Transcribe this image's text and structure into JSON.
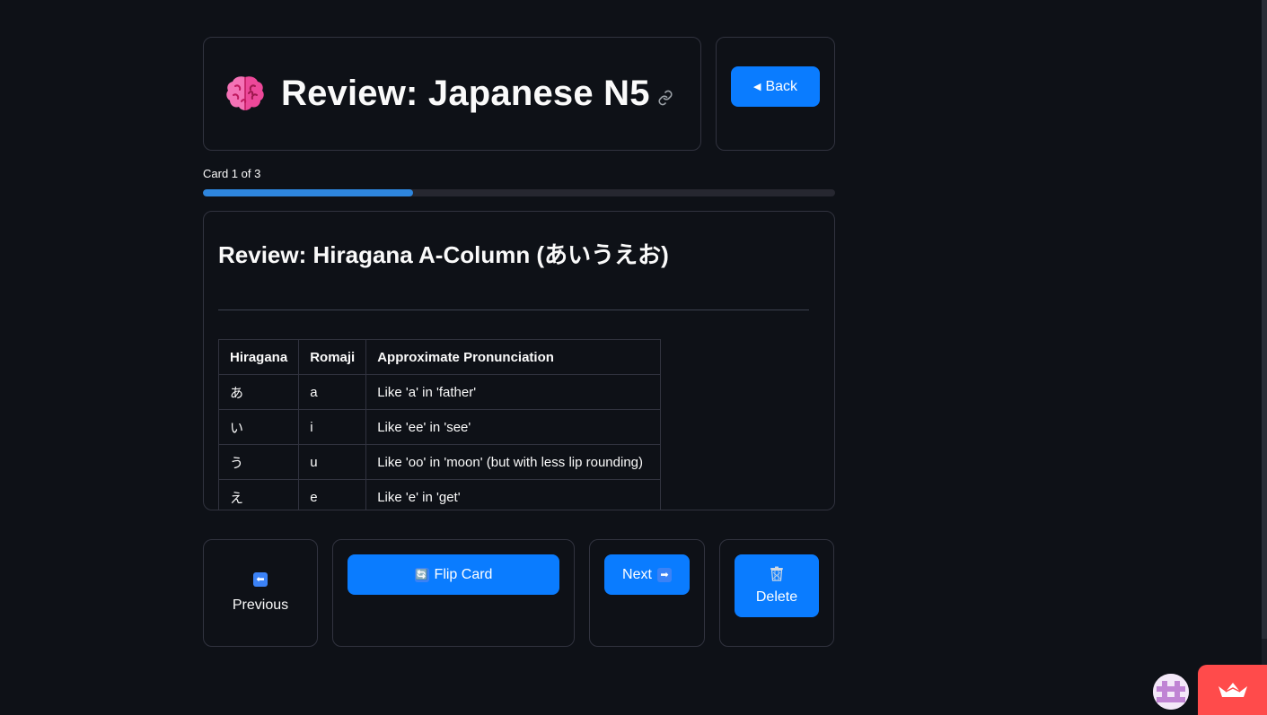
{
  "header": {
    "emoji_icon": "brain-icon",
    "title": "Review: Japanese N5",
    "anchor_icon": "link-icon"
  },
  "back_button": {
    "label": "Back",
    "icon": "left-triangle-icon"
  },
  "progress": {
    "label": "Card 1 of 3",
    "current": 1,
    "total": 3,
    "fraction": 0.333,
    "color": "#2e86de"
  },
  "card": {
    "title": "Review: Hiragana A-Column (あいうえお)",
    "table": {
      "headers": [
        "Hiragana",
        "Romaji",
        "Approximate Pronunciation"
      ],
      "rows": [
        [
          "あ",
          "a",
          "Like 'a' in 'father'"
        ],
        [
          "い",
          "i",
          "Like 'ee' in 'see'"
        ],
        [
          "う",
          "u",
          "Like 'oo' in 'moon' (but with less lip rounding)"
        ],
        [
          "え",
          "e",
          "Like 'e' in 'get'"
        ]
      ]
    }
  },
  "actions": {
    "previous": {
      "label": "Previous",
      "icon": "left-arrow-icon",
      "glyph": "⬅"
    },
    "flip": {
      "label": "Flip Card",
      "icon": "refresh-icon",
      "glyph": "🔄"
    },
    "next": {
      "label": "Next",
      "icon": "right-arrow-icon",
      "glyph": "➡"
    },
    "delete": {
      "label": "Delete",
      "icon": "trash-icon"
    }
  },
  "colors": {
    "background": "#0e1117",
    "primary_button": "#0a7cff",
    "panel_border": "#31333f",
    "streamlit_badge": "#ff4b4b"
  }
}
